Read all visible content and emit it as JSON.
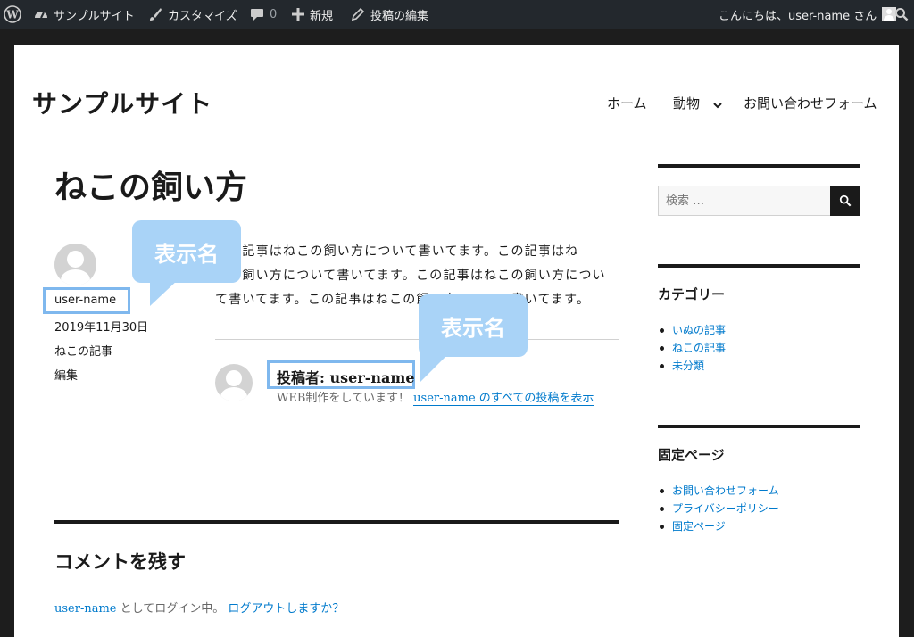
{
  "admin_bar": {
    "site_name": "サンプルサイト",
    "customize": "カスタマイズ",
    "comments_count": "0",
    "new": "新規",
    "edit_post": "投稿の編集",
    "greeting": "こんにちは、user-name さん"
  },
  "site": {
    "title": "サンプルサイト",
    "nav": {
      "home": "ホーム",
      "animals": "動物",
      "contact": "お問い合わせフォーム"
    }
  },
  "post": {
    "title": "ねこの飼い方",
    "author_display": "user-name",
    "date": "2019年11月30日",
    "category": "ねこの記事",
    "edit": "編集",
    "content_lines": [
      "この記事はねこの飼い方について書いてます。この記事はね",
      "この飼い方について書いてます。この記事はねこの飼い方につい",
      "て書いてます。この記事はねこの飼い方について書いてます。"
    ]
  },
  "author_box": {
    "heading_prefix": "投稿者:",
    "name": "user-name",
    "bio": "WEB制作をしています！",
    "link": "user-name のすべての投稿を表示"
  },
  "callouts": {
    "label_1": "表示名",
    "label_2": "表示名"
  },
  "sidebar": {
    "search_placeholder": "検索 …",
    "categories_title": "カテゴリー",
    "categories": [
      "いぬの記事",
      "ねこの記事",
      "未分類"
    ],
    "pages_title": "固定ページ",
    "pages": [
      "お問い合わせフォーム",
      "プライバシーポリシー",
      "固定ページ"
    ]
  },
  "comments": {
    "title": "コメントを残す",
    "logged_in_user": "user-name",
    "logged_in_text": "としてログイン中。",
    "logout": "ログアウトしますか？"
  },
  "colors": {
    "accent": "#7fb8ee",
    "callout": "#a9d3f7",
    "link": "#007acc",
    "admin_bar": "#23282d"
  }
}
